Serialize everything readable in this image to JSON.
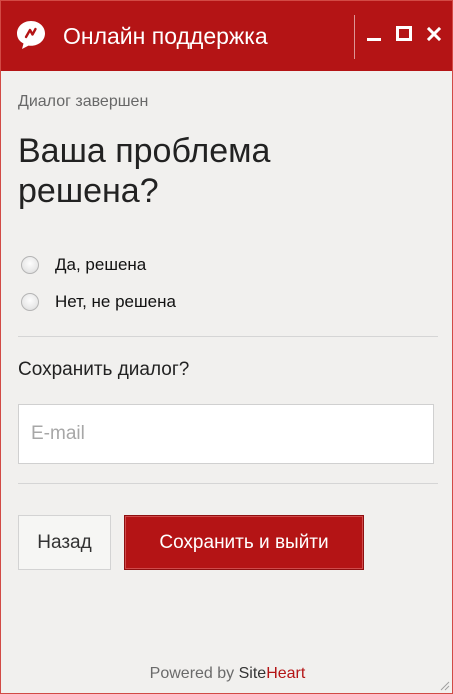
{
  "window": {
    "title": "Онлайн поддержка",
    "colors": {
      "accent": "#b41415",
      "background": "#f1f0ee"
    },
    "controls": {
      "minimize_icon": "minimize-icon",
      "maximize_icon": "maximize-icon",
      "close_icon": "close-icon"
    }
  },
  "dialog": {
    "status": "Диалог завершен",
    "question": "Ваша проблема решена?",
    "options": [
      {
        "label": "Да, решена",
        "selected": false
      },
      {
        "label": "Нет, не решена",
        "selected": false
      }
    ],
    "save_question": "Сохранить диалог?",
    "email": {
      "value": "",
      "placeholder": "E-mail"
    },
    "buttons": {
      "back": "Назад",
      "save_exit": "Сохранить и выйти"
    }
  },
  "footer": {
    "prefix": "Powered by ",
    "brand_part1": "Site",
    "brand_part2": "Heart"
  }
}
